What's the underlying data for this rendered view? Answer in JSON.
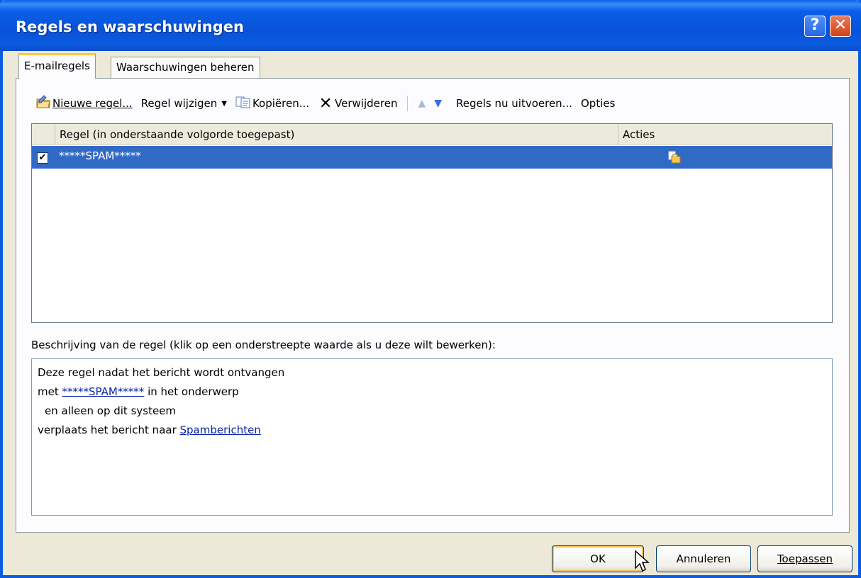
{
  "window": {
    "title": "Regels en waarschuwingen",
    "help_glyph": "?",
    "close_glyph": "✕"
  },
  "tabs": [
    {
      "label": "E-mailregels",
      "active": true
    },
    {
      "label": "Waarschuwingen beheren",
      "active": false
    }
  ],
  "toolbar": {
    "new_rule": "Nieuwe regel...",
    "change_rule": "Regel wijzigen",
    "copy": "Kopiëren...",
    "delete": "Verwijderen",
    "run_rules": "Regels nu uitvoeren...",
    "options": "Opties"
  },
  "rules_list": {
    "headers": {
      "rule": "Regel (in onderstaande volgorde toegepast)",
      "actions": "Acties"
    },
    "rows": [
      {
        "name": "*****SPAM*****",
        "checked": true
      }
    ]
  },
  "description": {
    "label": "Beschrijving van de regel (klik op een onderstreepte waarde als u deze wilt bewerken):",
    "line1": "Deze regel nadat het bericht wordt ontvangen",
    "line2_prefix": "met ",
    "line2_link": "*****SPAM*****",
    "line2_suffix": " in het onderwerp",
    "line3": "en alleen op dit systeem",
    "line4_prefix": "verplaats het bericht naar ",
    "line4_link": "Spamberichten"
  },
  "buttons": {
    "ok": "OK",
    "cancel": "Annuleren",
    "apply": "Toepassen"
  },
  "colors": {
    "title_blue": "#0a5ce0",
    "selection": "#316ac5",
    "link": "#0a24a8"
  }
}
